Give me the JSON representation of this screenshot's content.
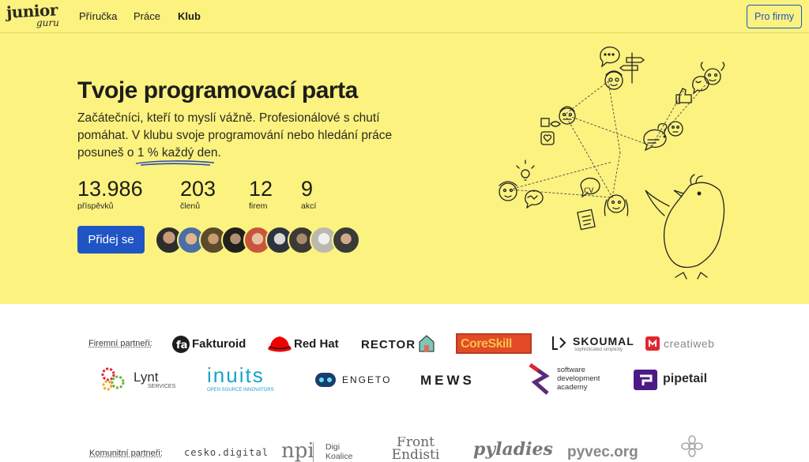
{
  "nav": {
    "logo_top": "junior",
    "logo_bottom": "guru",
    "links": [
      "Příručka",
      "Práce",
      "Klub"
    ],
    "active_index": 2,
    "cta": "Pro firmy"
  },
  "hero": {
    "title": "Tvoje programovací parta",
    "lead_pre": "Začátečníci, kteří to myslí vážně. Profesionálové s chutí pomáhat. V klubu svoje programování nebo hledání práce posuneš o ",
    "lead_highlight": "1 % každý den",
    "lead_post": ".",
    "stats": [
      {
        "value": "13.986",
        "label": "příspěvků"
      },
      {
        "value": "203",
        "label": "členů"
      },
      {
        "value": "12",
        "label": "firem"
      },
      {
        "value": "9",
        "label": "akcí"
      }
    ],
    "join_button": "Přidej se",
    "member_avatar_count": 9
  },
  "partners": {
    "corporate_label": "Firemní partneři:",
    "corporate": [
      "Fakturoid",
      "Red Hat",
      "RECTOR",
      "CoreSkill",
      "SKOUMAL",
      "creatiweb",
      "Lynt",
      "inuits",
      "ENGETO",
      "MEWS",
      "software development academy",
      "pipetail"
    ],
    "skoumal_tagline": "sophisticated simplicity",
    "lynt_sub": "SERVICES",
    "inuits_sub": "OPEN SOURCE INNOVATORS",
    "community_label": "Komunitní partneři:",
    "community": [
      "cesko.digital",
      "npi",
      "Digi Koalice",
      "Front Endisti",
      "pyladies",
      "pyvec.org"
    ]
  },
  "colors": {
    "hero_bg": "#fcf27f",
    "primary": "#1f55c4",
    "redhat": "#ee0000",
    "inuits": "#1aa4c8",
    "pipetail": "#4b1a86"
  }
}
